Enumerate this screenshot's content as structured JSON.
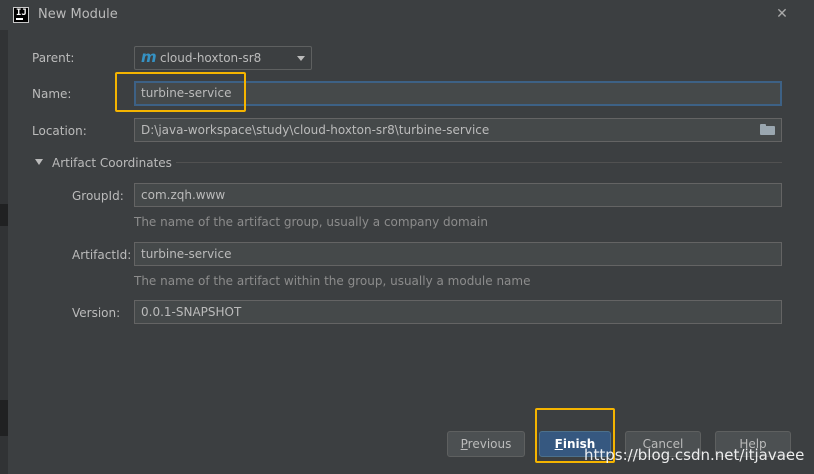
{
  "window": {
    "title": "New Module",
    "app_icon": "intellij-idea-icon",
    "close_icon": "close-x-icon"
  },
  "form": {
    "parent": {
      "label": "Parent:",
      "icon": "maven-m-icon",
      "icon_glyph": "m",
      "value": "cloud-hoxton-sr8"
    },
    "name": {
      "label": "Name:",
      "value": "turbine-service"
    },
    "location": {
      "label": "Location:",
      "value": "D:\\java-workspace\\study\\cloud-hoxton-sr8\\turbine-service",
      "browse_icon": "folder-icon"
    },
    "artifact_coordinates": {
      "title": "Artifact Coordinates",
      "group_id": {
        "label": "GroupId:",
        "value": "com.zqh.www",
        "hint": "The name of the artifact group, usually a company domain"
      },
      "artifact_id": {
        "label": "ArtifactId:",
        "value": "turbine-service",
        "hint": "The name of the artifact within the group, usually a module name"
      },
      "version": {
        "label": "Version:",
        "value": "0.0.1-SNAPSHOT"
      }
    }
  },
  "buttons": {
    "previous": {
      "mnemonic": "P",
      "rest": "revious"
    },
    "finish": {
      "mnemonic": "F",
      "rest": "inish"
    },
    "cancel": {
      "label": "Cancel"
    },
    "help": {
      "label": "Help"
    }
  },
  "annotations": {
    "highlight_color": "#f5b400"
  },
  "watermark": {
    "text": "https://blog.csdn.net/itjavaee"
  },
  "colors": {
    "background": "#3c3f41",
    "field_bg": "#45494a",
    "focus_border": "#3d6185",
    "primary_button": "#365880",
    "text": "#bbbbbb",
    "hint_text": "#8c8c8c"
  }
}
